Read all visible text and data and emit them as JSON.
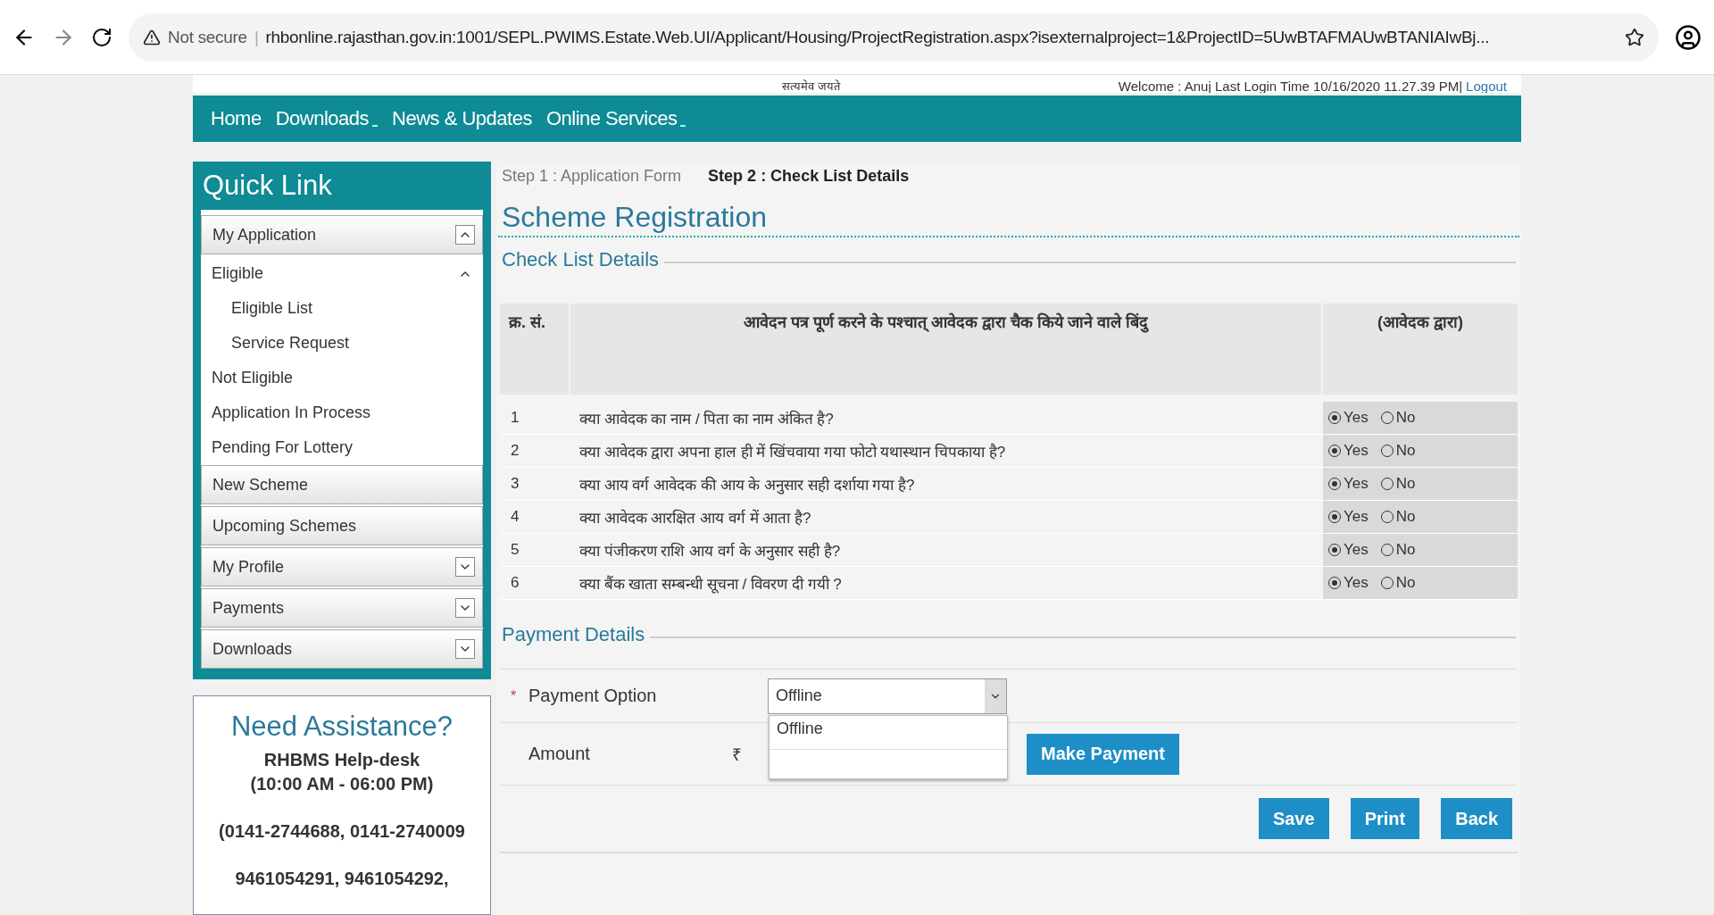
{
  "browser": {
    "security": "Not secure",
    "separator": "|",
    "url": "rhbonline.rajasthan.gov.in:1001/SEPL.PWIMS.Estate.Web.UI/Applicant/Housing/ProjectRegistration.aspx?isexternalproject=1&ProjectID=5UwBTAFMAUwBTANIAIwBj..."
  },
  "header": {
    "motto": "सत्यमेव जयते",
    "welcome": "Welcome : Anuj Last Login Time 10/16/2020 11.27.39 PM|",
    "logout": "Logout"
  },
  "nav": [
    {
      "label": "Home",
      "dropdown": false
    },
    {
      "label": "Downloads",
      "dropdown": true
    },
    {
      "label": "News & Updates",
      "dropdown": false
    },
    {
      "label": "Online Services",
      "dropdown": true
    }
  ],
  "sidebar": {
    "title": "Quick Link",
    "items": [
      {
        "label": "My Application",
        "expanded": true,
        "children": [
          {
            "label": "Eligible",
            "expanded": true,
            "children": [
              {
                "label": "Eligible List"
              },
              {
                "label": "Service Request"
              }
            ]
          },
          {
            "label": "Not Eligible"
          },
          {
            "label": "Application In Process"
          },
          {
            "label": "Pending For Lottery"
          }
        ]
      },
      {
        "label": "New Scheme"
      },
      {
        "label": "Upcoming Schemes"
      },
      {
        "label": "My Profile",
        "expanded": false
      },
      {
        "label": "Payments",
        "expanded": false
      },
      {
        "label": "Downloads",
        "expanded": false
      }
    ]
  },
  "assistance": {
    "title": "Need Assistance?",
    "lines": [
      "RHBMS Help-desk",
      "(10:00 AM - 06:00 PM)",
      "(0141-2744688, 0141-2740009",
      "9461054291, 9461054292,"
    ]
  },
  "steps": [
    {
      "label": "Step 1 : Application Form",
      "selected": false
    },
    {
      "label": "Step 2 : Check List Details",
      "selected": true
    }
  ],
  "page_title": "Scheme Registration",
  "checklist": {
    "title": "Check List Details",
    "columns": [
      "क्र. सं.",
      "आवेदन पत्र पूर्ण करने के पश्चात् आवेदक द्वारा चैक किये जाने वाले बिंदु",
      "(आवेदक द्वारा)"
    ],
    "rows": [
      {
        "no": "1",
        "text": "क्या आवेदक का नाम / पिता का नाम अंकित है?",
        "options": [
          {
            "label": "Yes",
            "selected": true
          },
          {
            "label": "No",
            "selected": false
          }
        ]
      },
      {
        "no": "2",
        "text": "क्या आवेदक द्वारा अपना हाल ही में खिंचवाया गया फोटो यथास्थान चिपकाया है?",
        "options": [
          {
            "label": "Yes",
            "selected": true
          },
          {
            "label": "No",
            "selected": false
          }
        ]
      },
      {
        "no": "3",
        "text": "क्या आय वर्ग आवेदक की आय के अनुसार सही दर्शाया गया है?",
        "options": [
          {
            "label": "Yes",
            "selected": true
          },
          {
            "label": "No",
            "selected": false
          }
        ]
      },
      {
        "no": "4",
        "text": "क्या आवेदक आरक्षित आय वर्ग में आता है?",
        "options": [
          {
            "label": "Yes",
            "selected": true
          },
          {
            "label": "No",
            "selected": false
          }
        ]
      },
      {
        "no": "5",
        "text": "क्या पंजीकरण राशि आय वर्ग के अनुसार सही है?",
        "options": [
          {
            "label": "Yes",
            "selected": true
          },
          {
            "label": "No",
            "selected": false
          }
        ]
      },
      {
        "no": "6",
        "text": "क्या बैंक खाता सम्बन्धी सूचना / विवरण दी गयी ?",
        "options": [
          {
            "label": "Yes",
            "selected": true
          },
          {
            "label": "No",
            "selected": false
          }
        ]
      }
    ]
  },
  "payment": {
    "title": "Payment Details",
    "option_label": "Payment Option",
    "required_mark": "*",
    "option_value": "Offline",
    "open": true,
    "options": [
      "Offline"
    ],
    "amount_label": "Amount",
    "amount_currency": "₹",
    "make_payment": "Make Payment"
  },
  "buttons": [
    "Save",
    "Print",
    "Back"
  ]
}
